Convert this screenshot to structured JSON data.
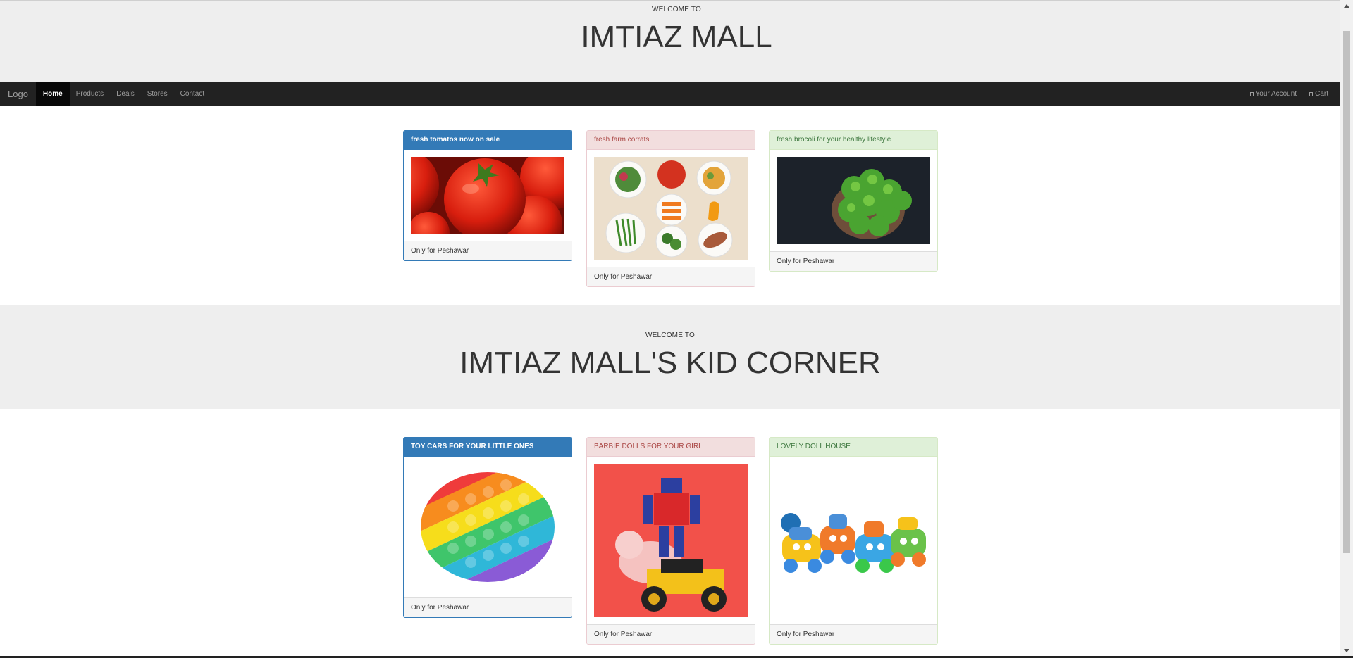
{
  "header": {
    "welcome": "WELCOME TO",
    "title": "IMTIAZ MALL"
  },
  "navbar": {
    "brand": "Logo",
    "items": [
      "Home",
      "Products",
      "Deals",
      "Stores",
      "Contact"
    ],
    "account": "Your Account",
    "cart": "Cart"
  },
  "produce": [
    {
      "title": "fresh tomatos now on sale",
      "footer": "Only for Peshawar",
      "style": "primary"
    },
    {
      "title": "fresh farm corrats",
      "footer": "Only for Peshawar",
      "style": "danger"
    },
    {
      "title": "fresh brocoli for your healthy lifestyle",
      "footer": "Only for Peshawar",
      "style": "success"
    }
  ],
  "kids_header": {
    "welcome": "WELCOME TO",
    "title": "IMTIAZ MALL'S KID CORNER"
  },
  "toys": [
    {
      "title": "TOY CARS FOR YOUR LITTLE ONES",
      "footer": "Only for Peshawar",
      "style": "primary"
    },
    {
      "title": "BARBIE DOLLS FOR YOUR GIRL",
      "footer": "Only for Peshawar",
      "style": "danger"
    },
    {
      "title": "LOVELY DOLL HOUSE",
      "footer": "Only for Peshawar",
      "style": "success"
    }
  ],
  "colors": {
    "primary": "#337ab7",
    "danger": "#f2dede",
    "success": "#dff0d8",
    "navbar": "#222222",
    "jumbotron": "#eeeeee"
  }
}
